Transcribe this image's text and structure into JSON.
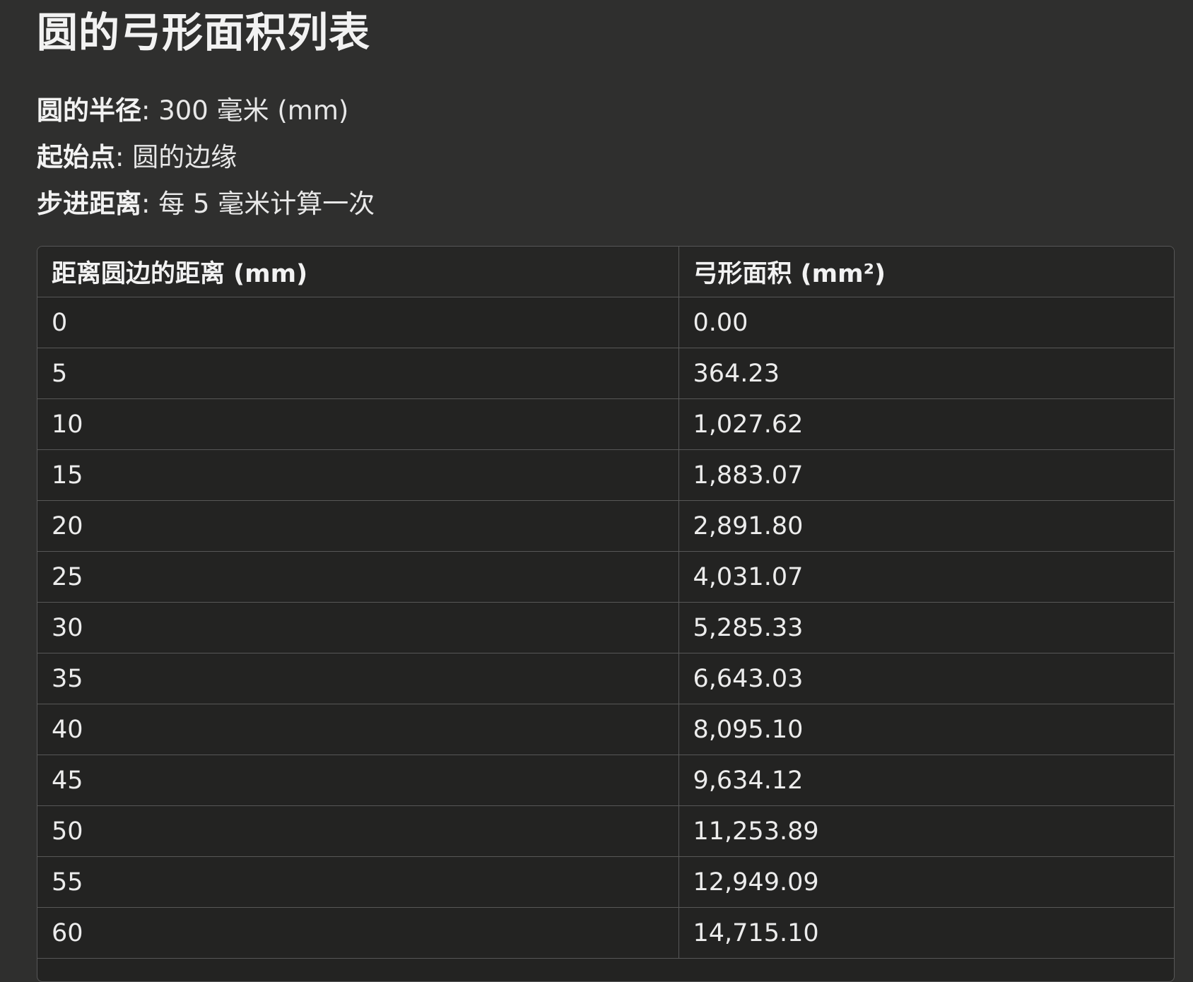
{
  "title": "圆的弓形面积列表",
  "meta": [
    {
      "label": "圆的半径",
      "value": ": 300 毫米 (mm)"
    },
    {
      "label": "起始点",
      "value": ": 圆的边缘"
    },
    {
      "label": "步进距离",
      "value": ": 每 5 毫米计算一次"
    }
  ],
  "table": {
    "headers": [
      "距离圆边的距离 (mm)",
      "弓形面积 (mm²)"
    ],
    "rows": [
      [
        "0",
        "0.00"
      ],
      [
        "5",
        "364.23"
      ],
      [
        "10",
        "1,027.62"
      ],
      [
        "15",
        "1,883.07"
      ],
      [
        "20",
        "2,891.80"
      ],
      [
        "25",
        "4,031.07"
      ],
      [
        "30",
        "5,285.33"
      ],
      [
        "35",
        "6,643.03"
      ],
      [
        "40",
        "8,095.10"
      ],
      [
        "45",
        "9,634.12"
      ],
      [
        "50",
        "11,253.89"
      ],
      [
        "55",
        "12,949.09"
      ],
      [
        "60",
        "14,715.10"
      ]
    ]
  }
}
